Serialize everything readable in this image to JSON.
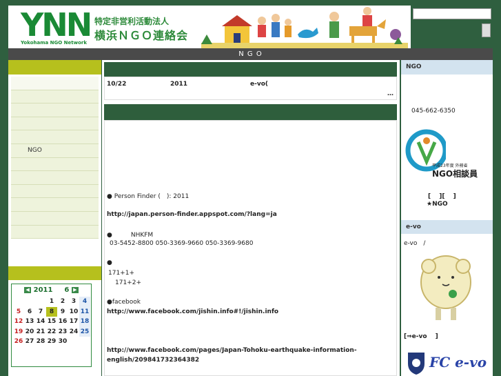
{
  "header": {
    "logo_text": "YNN",
    "logo_sub": "Yokohama NGO Network",
    "org_line1": "特定非営利活動法人",
    "org_line2": "横浜ＮＧＯ連絡会"
  },
  "search": {
    "placeholder": ""
  },
  "nav": {
    "label": "N G O"
  },
  "left": {
    "menu": [
      "",
      "",
      "",
      "",
      "",
      "NGO",
      "",
      "",
      "",
      "",
      "",
      ""
    ]
  },
  "calendar": {
    "prev_icon": "◀",
    "next_icon": "▶",
    "year": "2011",
    "month": "6",
    "weeks": [
      [
        "",
        "",
        "",
        "1",
        "2",
        "3",
        "4"
      ],
      [
        "5",
        "6",
        "7",
        "8",
        "9",
        "10",
        "11"
      ],
      [
        "12",
        "13",
        "14",
        "15",
        "16",
        "17",
        "18"
      ],
      [
        "19",
        "20",
        "21",
        "22",
        "23",
        "24",
        "25"
      ],
      [
        "26",
        "27",
        "28",
        "29",
        "30",
        "",
        ""
      ]
    ],
    "today": "8"
  },
  "news": {
    "date": "10/22",
    "year": "2011",
    "title": "e-vo(",
    "more": "…"
  },
  "article": {
    "line1": "● Person Finder (　): 2011",
    "line2": "http://japan.person-finder.appspot.com/?lang=ja",
    "line3": "●　　　NHKFM",
    "line4": "03-5452-8800 050-3369-9660 050-3369-9680",
    "line5": "●",
    "line6": "171+1+",
    "line7": "171+2+",
    "line8": "●facebook",
    "line9": "http://www.facebook.com/jishin.info#!/jishin.info",
    "line10": "http://www.facebook.com/pages/Japan-Tohoku-earthquake-information-",
    "line11": "english/209841732364382"
  },
  "right": {
    "ngo_head": "NGO",
    "phone": "045-662-6350",
    "badge_caption_small": "平成23年度 外務省",
    "badge_caption_big": "NGO相談員",
    "link_brackets": "[　 ][　 ]",
    "star_ngo": "★NGO",
    "evo_head": "e-vo",
    "evo_text": "e-vo　/",
    "evo_link": "[⇒e-vo　 ]",
    "fc_label": "FC e-vo"
  },
  "colors": {
    "brand_green": "#1a8a35",
    "dark_green": "#2e5e3c",
    "olive": "#b6c01d",
    "nav_gray": "#4a4a4a",
    "right_head": "#d3e3ef"
  }
}
